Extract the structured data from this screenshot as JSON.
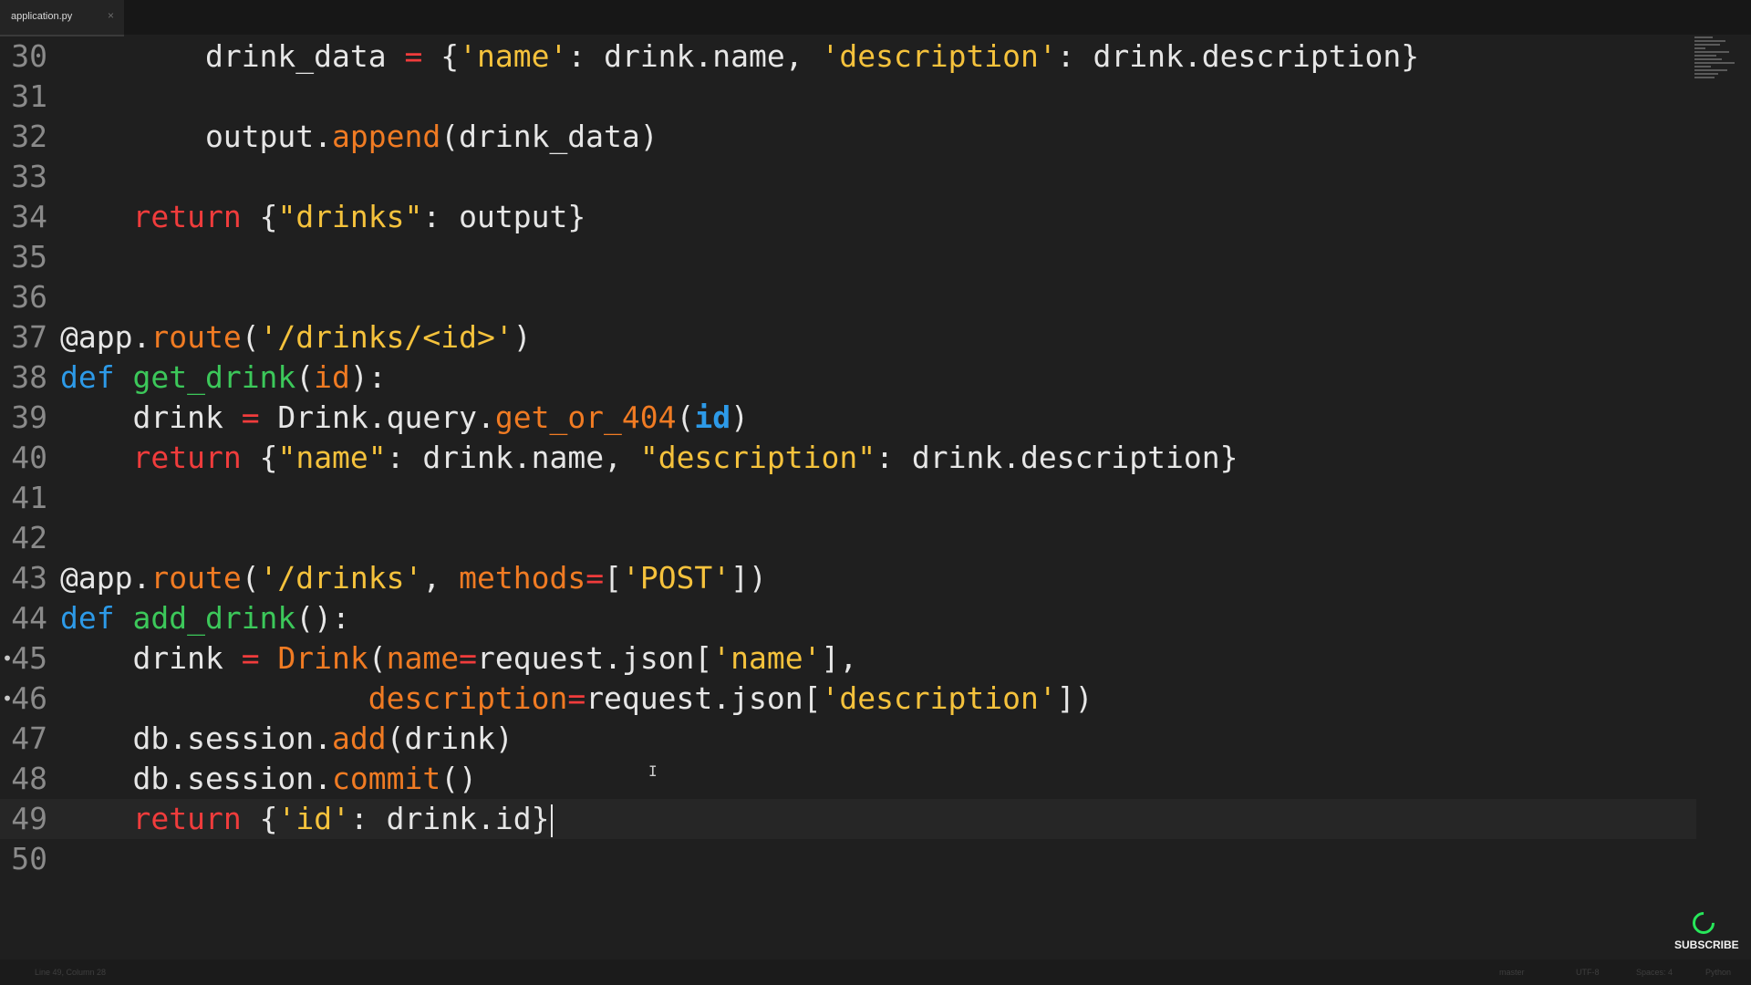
{
  "tab": {
    "filename": "application.py",
    "close_icon": "×"
  },
  "code_lines": [
    {
      "n": "30",
      "tokens": [
        [
          "    ",
          ""
        ],
        [
          "    drink_data ",
          ""
        ],
        [
          "=",
          "op"
        ],
        [
          " {",
          ""
        ],
        [
          "'name'",
          "str"
        ],
        [
          ": drink.name, ",
          ""
        ],
        [
          "'description'",
          "str"
        ],
        [
          ": drink.description}",
          ""
        ]
      ]
    },
    {
      "n": "31",
      "tokens": []
    },
    {
      "n": "32",
      "tokens": [
        [
          "        output.",
          ""
        ],
        [
          "append",
          "mth"
        ],
        [
          "(drink_data)",
          ""
        ]
      ]
    },
    {
      "n": "33",
      "tokens": []
    },
    {
      "n": "34",
      "tokens": [
        [
          "    ",
          ""
        ],
        [
          "return",
          "kw"
        ],
        [
          " {",
          ""
        ],
        [
          "\"drinks\"",
          "str"
        ],
        [
          ": output}",
          ""
        ]
      ]
    },
    {
      "n": "35",
      "tokens": []
    },
    {
      "n": "36",
      "tokens": []
    },
    {
      "n": "37",
      "tokens": [
        [
          "@app.",
          ""
        ],
        [
          "route",
          "mth"
        ],
        [
          "(",
          ""
        ],
        [
          "'/drinks/<id>'",
          "str"
        ],
        [
          ")",
          ""
        ]
      ]
    },
    {
      "n": "38",
      "tokens": [
        [
          "def",
          "kw2"
        ],
        [
          " ",
          ""
        ],
        [
          "get_drink",
          "fn"
        ],
        [
          "(",
          ""
        ],
        [
          "id",
          "prm"
        ],
        [
          "):",
          ""
        ]
      ]
    },
    {
      "n": "39",
      "tokens": [
        [
          "    drink ",
          ""
        ],
        [
          "=",
          "op"
        ],
        [
          " Drink.query.",
          ""
        ],
        [
          "get_or_404",
          "mth"
        ],
        [
          "(",
          ""
        ],
        [
          "id",
          "num"
        ],
        [
          ")",
          ""
        ]
      ]
    },
    {
      "n": "40",
      "tokens": [
        [
          "    ",
          ""
        ],
        [
          "return",
          "kw"
        ],
        [
          " {",
          ""
        ],
        [
          "\"name\"",
          "str"
        ],
        [
          ": drink.name, ",
          ""
        ],
        [
          "\"description\"",
          "str"
        ],
        [
          ": drink.description}",
          ""
        ]
      ]
    },
    {
      "n": "41",
      "tokens": []
    },
    {
      "n": "42",
      "tokens": []
    },
    {
      "n": "43",
      "tokens": [
        [
          "@app.",
          ""
        ],
        [
          "route",
          "mth"
        ],
        [
          "(",
          ""
        ],
        [
          "'/drinks'",
          "str"
        ],
        [
          ", ",
          ""
        ],
        [
          "methods",
          "prm"
        ],
        [
          "=",
          "op"
        ],
        [
          "[",
          ""
        ],
        [
          "'POST'",
          "str"
        ],
        [
          "])",
          ""
        ]
      ]
    },
    {
      "n": "44",
      "tokens": [
        [
          "def",
          "kw2"
        ],
        [
          " ",
          ""
        ],
        [
          "add_drink",
          "fn"
        ],
        [
          "():",
          ""
        ]
      ]
    },
    {
      "n": "45",
      "dot": true,
      "tokens": [
        [
          "    drink ",
          ""
        ],
        [
          "=",
          "op"
        ],
        [
          " ",
          ""
        ],
        [
          "Drink",
          "mth"
        ],
        [
          "(",
          ""
        ],
        [
          "name",
          "prm"
        ],
        [
          "=",
          "op"
        ],
        [
          "request.json[",
          ""
        ],
        [
          "'name'",
          "str"
        ],
        [
          "],",
          ""
        ]
      ]
    },
    {
      "n": "46",
      "dot": true,
      "tokens": [
        [
          "                 ",
          ""
        ],
        [
          "description",
          "prm"
        ],
        [
          "=",
          "op"
        ],
        [
          "request.json[",
          ""
        ],
        [
          "'description'",
          "str"
        ],
        [
          "])",
          ""
        ]
      ]
    },
    {
      "n": "47",
      "tokens": [
        [
          "    db.session.",
          ""
        ],
        [
          "add",
          "mth"
        ],
        [
          "(drink)",
          ""
        ]
      ]
    },
    {
      "n": "48",
      "tokens": [
        [
          "    db.session.",
          ""
        ],
        [
          "commit",
          "mth"
        ],
        [
          "()",
          ""
        ]
      ]
    },
    {
      "n": "49",
      "active": true,
      "cursor": true,
      "tokens": [
        [
          "    ",
          ""
        ],
        [
          "return",
          "kw"
        ],
        [
          " {",
          ""
        ],
        [
          "'id'",
          "str"
        ],
        [
          ": drink.id}",
          ""
        ]
      ]
    },
    {
      "n": "50",
      "tokens": []
    }
  ],
  "status": {
    "position": "Line 49, Column 28",
    "branch": "master",
    "encoding": "UTF-8",
    "indent": "Spaces: 4",
    "syntax": "Python"
  },
  "overlay": {
    "subscribe_label": "SUBSCRIBE"
  }
}
